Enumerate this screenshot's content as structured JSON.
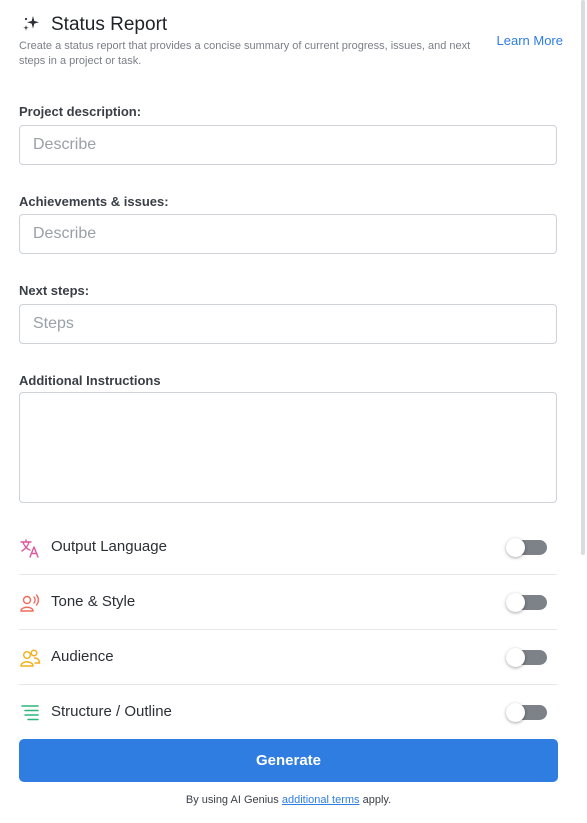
{
  "header": {
    "title": "Status Report",
    "subtitle": "Create a status report that provides a concise summary of current progress, issues, and next steps in a project or task.",
    "learn_more": "Learn More",
    "icon": "sparkle-icon"
  },
  "form": {
    "project_description": {
      "label": "Project description:",
      "placeholder": "Describe",
      "value": ""
    },
    "achievements": {
      "label": "Achievements & issues:",
      "placeholder": "Describe",
      "value": ""
    },
    "next_steps": {
      "label": "Next steps:",
      "placeholder": "Steps",
      "value": ""
    },
    "additional": {
      "label": "Additional Instructions",
      "value": ""
    }
  },
  "options": [
    {
      "label": "Output Language",
      "icon": "translate-icon",
      "color": "#e0569b",
      "enabled": false
    },
    {
      "label": "Tone & Style",
      "icon": "speaking-person-icon",
      "color": "#ef6b5b",
      "enabled": false
    },
    {
      "label": "Audience",
      "icon": "people-icon",
      "color": "#f2b01e",
      "enabled": false
    },
    {
      "label": "Structure / Outline",
      "icon": "outline-list-icon",
      "color": "#2fb57a",
      "enabled": false
    }
  ],
  "generate_label": "Generate",
  "terms": {
    "prefix": "By using AI Genius",
    "link": "additional terms",
    "suffix": "apply."
  },
  "colors": {
    "accent": "#2f7de1",
    "toggle_off": "#7d8188"
  }
}
